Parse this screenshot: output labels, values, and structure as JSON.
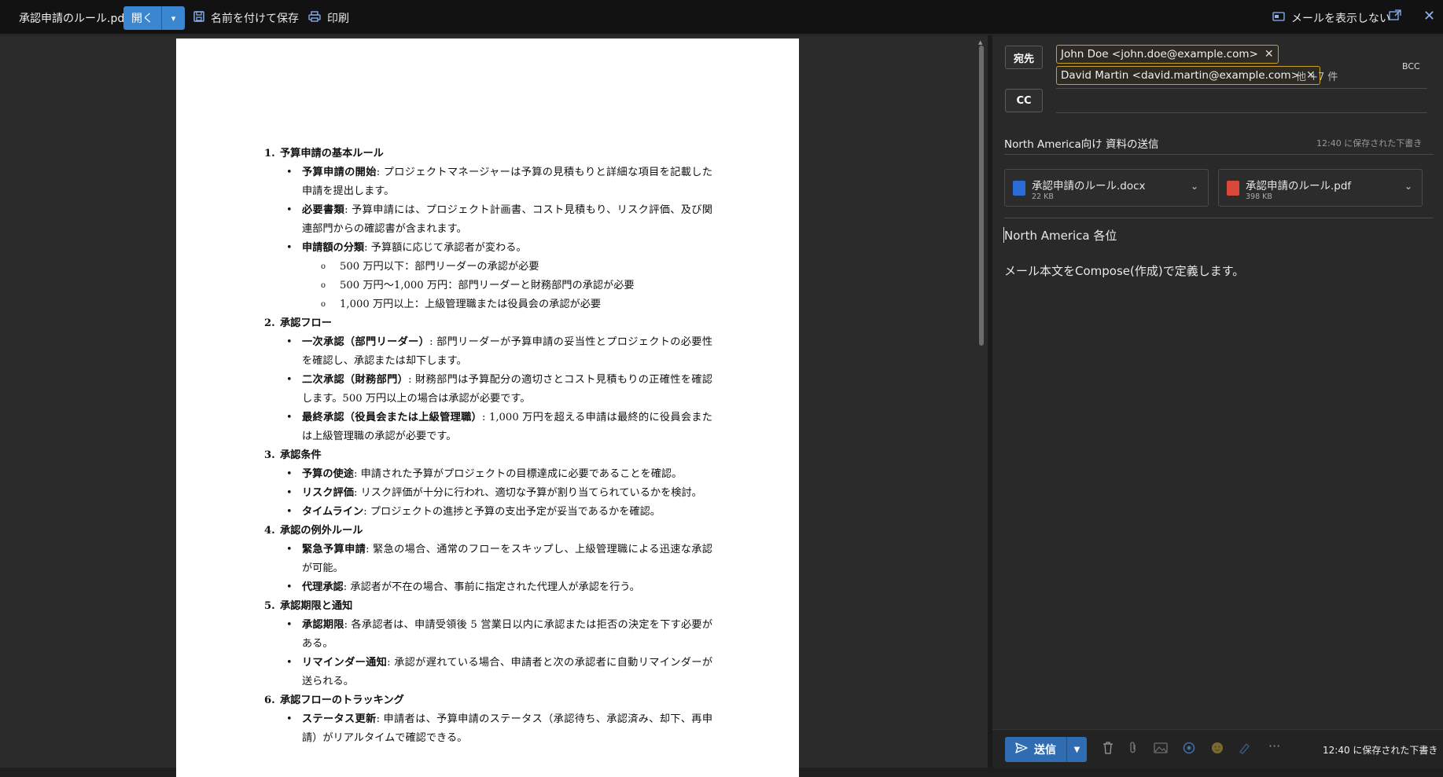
{
  "toolbar": {
    "doc_title": "承認申請のルール.pdf",
    "open_label": "開く",
    "save_as_label": "名前を付けて保存",
    "print_label": "印刷",
    "hide_mail_label": "メールを表示しない",
    "icons": [
      "chevron-down-icon",
      "save-icon",
      "print-icon",
      "hide-mail-icon",
      "popout-icon",
      "close-icon"
    ]
  },
  "document": {
    "sections": [
      {
        "num": "1.",
        "title": "予算申請の基本ルール",
        "items": [
          {
            "term": "予算申請の開始",
            "text": ": プロジェクトマネージャーは予算の見積もりと詳細な項目を記載した申請を提出します。"
          },
          {
            "term": "必要書類",
            "text": ": 予算申請には、プロジェクト計画書、コスト見積もり、リスク評価、及び関連部門からの確認書が含まれます。"
          },
          {
            "term": "申請額の分類",
            "text": ": 予算額に応じて承認者が変わる。",
            "subs": [
              "500 万円以下：部門リーダーの承認が必要",
              "500 万円〜1,000 万円：部門リーダーと財務部門の承認が必要",
              "1,000 万円以上：上級管理職または役員会の承認が必要"
            ]
          }
        ]
      },
      {
        "num": "2.",
        "title": "承認フロー",
        "items": [
          {
            "term": "一次承認（部門リーダー）",
            "text": ": 部門リーダーが予算申請の妥当性とプロジェクトの必要性を確認し、承認または却下します。"
          },
          {
            "term": "二次承認（財務部門）",
            "text": ": 財務部門は予算配分の適切さとコスト見積もりの正確性を確認します。500 万円以上の場合は承認が必要です。"
          },
          {
            "term": "最終承認（役員会または上級管理職）",
            "text": ": 1,000 万円を超える申請は最終的に役員会または上級管理職の承認が必要です。"
          }
        ]
      },
      {
        "num": "3.",
        "title": "承認条件",
        "items": [
          {
            "term": "予算の使途",
            "text": ": 申請された予算がプロジェクトの目標達成に必要であることを確認。"
          },
          {
            "term": "リスク評価",
            "text": ": リスク評価が十分に行われ、適切な予算が割り当てられているかを検討。"
          },
          {
            "term": "タイムライン",
            "text": ": プロジェクトの進捗と予算の支出予定が妥当であるかを確認。"
          }
        ]
      },
      {
        "num": "4.",
        "title": "承認の例外ルール",
        "items": [
          {
            "term": "緊急予算申請",
            "text": ": 緊急の場合、通常のフローをスキップし、上級管理職による迅速な承認が可能。"
          },
          {
            "term": "代理承認",
            "text": ": 承認者が不在の場合、事前に指定された代理人が承認を行う。"
          }
        ]
      },
      {
        "num": "5.",
        "title": "承認期限と通知",
        "items": [
          {
            "term": "承認期限",
            "text": ": 各承認者は、申請受領後 5 営業日以内に承認または拒否の決定を下す必要がある。"
          },
          {
            "term": "リマインダー通知",
            "text": ": 承認が遅れている場合、申請者と次の承認者に自動リマインダーが送られる。"
          }
        ]
      },
      {
        "num": "6.",
        "title": "承認フローのトラッキング",
        "items": [
          {
            "term": "ステータス更新",
            "text": ": 申請者は、予算申請のステータス（承認待ち、承認済み、却下、再申請）がリアルタイムで確認できる。"
          }
        ]
      }
    ]
  },
  "compose": {
    "to_label": "宛先",
    "cc_label": "CC",
    "bcc_label": "BCC",
    "recipients": [
      "John Doe <john.doe@example.com>",
      "David Martin <david.martin@example.com>"
    ],
    "more_recipients": "他 +7 件",
    "subject": "North America向け 資料の送信",
    "saved_top": "12:40 に保存された下書き",
    "attachments": [
      {
        "name": "承認申請のルール.docx",
        "size": "22 KB",
        "icon": "word-file-icon",
        "color": "#2b6cd4"
      },
      {
        "name": "承認申請のルール.pdf",
        "size": "398 KB",
        "icon": "pdf-file-icon",
        "color": "#d8493a"
      }
    ],
    "greeting": "North America 各位",
    "body": "メール本文をCompose(作成)で定義します。",
    "send_label": "送信",
    "saved_bottom": "12:40 に保存された下書き",
    "tool_icons": [
      "delete-icon",
      "attach-icon",
      "image-icon",
      "loop-icon",
      "emoji-icon",
      "signature-icon",
      "more-icon"
    ]
  }
}
